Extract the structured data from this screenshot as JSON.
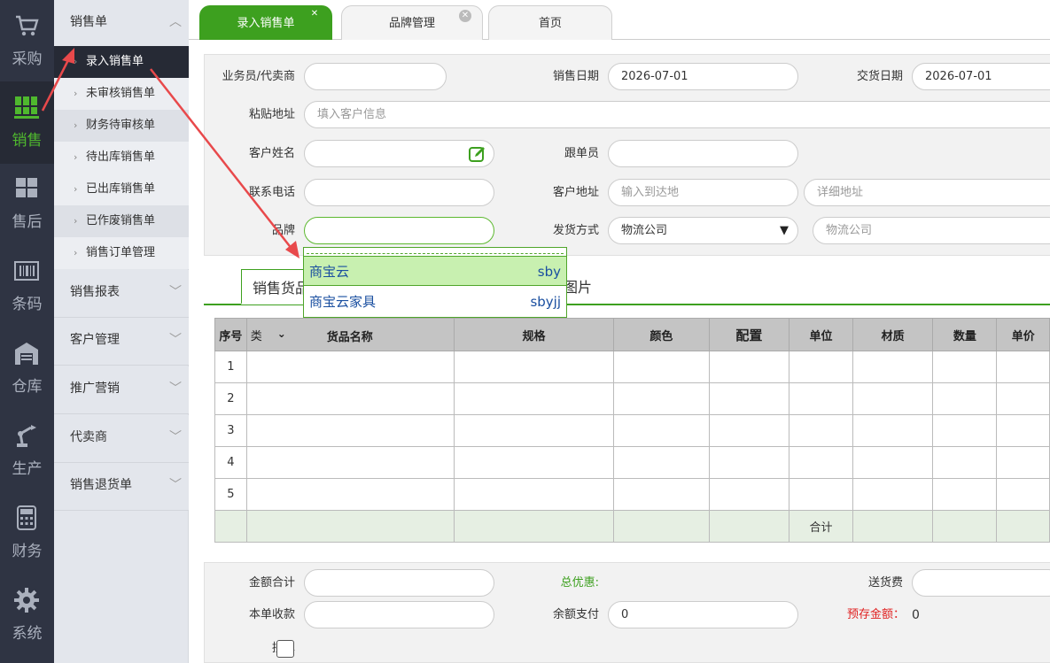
{
  "rail": {
    "items": [
      {
        "label": "采购",
        "icon": "cart-icon"
      },
      {
        "label": "销售",
        "icon": "pallet-icon"
      },
      {
        "label": "售后",
        "icon": "boxes-icon"
      },
      {
        "label": "条码",
        "icon": "barcode-icon"
      },
      {
        "label": "仓库",
        "icon": "warehouse-icon"
      },
      {
        "label": "生产",
        "icon": "robot-arm-icon"
      },
      {
        "label": "财务",
        "icon": "calculator-icon"
      },
      {
        "label": "系统",
        "icon": "gear-icon"
      }
    ]
  },
  "menu": {
    "sales_order": "销售单",
    "sub": [
      "录入销售单",
      "未审核销售单",
      "财务待审核单",
      "待出库销售单",
      "已出库销售单",
      "已作废销售单",
      "销售订单管理"
    ],
    "groups": [
      "销售报表",
      "客户管理",
      "推广营销",
      "代卖商",
      "销售退货单"
    ]
  },
  "tabs": [
    "录入销售单",
    "品牌管理",
    "首页"
  ],
  "form": {
    "salesperson_label": "业务员/代卖商",
    "sales_date_label": "销售日期",
    "sales_date": "2026-07-01",
    "delivery_date_label": "交货日期",
    "delivery_date": "2026-07-01",
    "paste_address_label": "粘贴地址",
    "paste_address_placeholder": "填入客户信息",
    "customer_name_label": "客户姓名",
    "follower_label": "跟单员",
    "phone_label": "联系电话",
    "customer_address_label": "客户地址",
    "address_to_placeholder": "输入到达地",
    "address_detail_placeholder": "详细地址",
    "brand_label": "品牌",
    "shipping_label": "发货方式",
    "shipping_value": "物流公司",
    "logistics_placeholder": "物流公司"
  },
  "dropdown": [
    {
      "name": "商宝云",
      "code": "sby"
    },
    {
      "name": "商宝云家具",
      "code": "sbyjj"
    }
  ],
  "goods_tabs": [
    "销售货品",
    "单图片"
  ],
  "table": {
    "headers": [
      "序号",
      "类",
      "货品名称",
      "规格",
      "颜色",
      "配置",
      "单位",
      "材质",
      "数量",
      "单价"
    ],
    "rows": [
      "1",
      "2",
      "3",
      "4",
      "5"
    ],
    "sum_label": "合计"
  },
  "bottom": {
    "amount_total_label": "金额合计",
    "total_discount_label": "总优惠:",
    "delivery_fee_label": "送货费",
    "received_label": "本单收款",
    "balance_pay_label": "余额支付",
    "balance_pay_value": "0",
    "prepaid_label": "预存金额：",
    "prepaid_value": "0",
    "combine_label": "拼单"
  },
  "colors": {
    "accent": "#3da01f",
    "rail": "#2f3443",
    "arrow": "#e8494b"
  }
}
